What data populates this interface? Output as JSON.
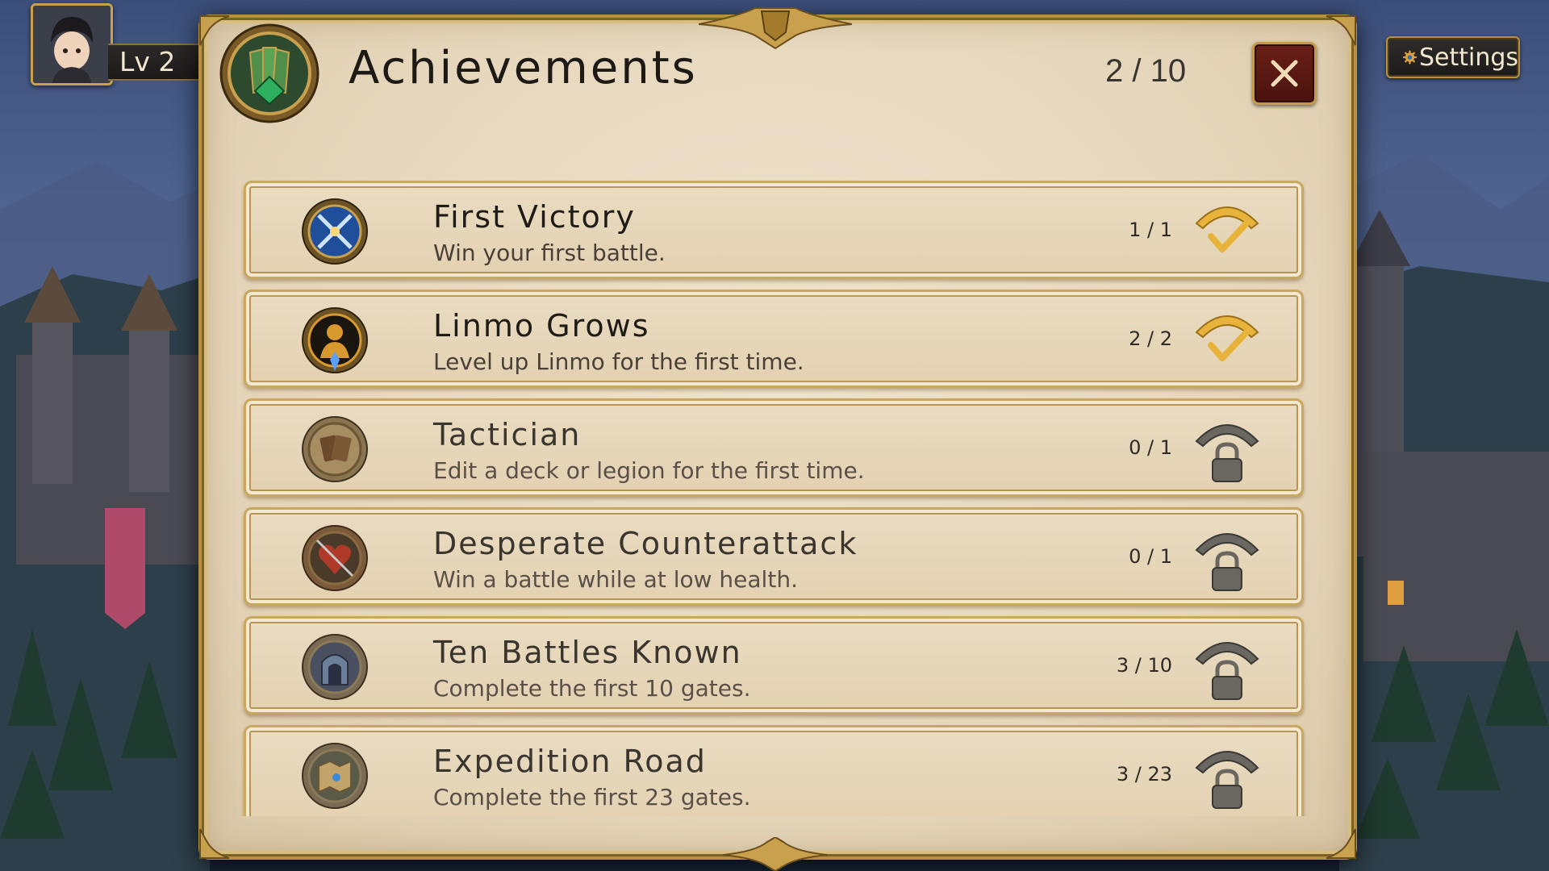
{
  "hud": {
    "level_label": "Lv 2",
    "settings_label": "Settings"
  },
  "panel": {
    "title": "Achievements",
    "count": "2 / 10"
  },
  "achievements": [
    {
      "title": "First Victory",
      "desc": "Win your first battle.",
      "progress": "1 / 1",
      "status": "completed",
      "icon": "crossed-swords-icon",
      "icon_color": "#3f7fd8"
    },
    {
      "title": "Linmo Grows",
      "desc": "Level up Linmo for the first time.",
      "progress": "2 / 2",
      "status": "completed",
      "icon": "hero-silhouette-icon",
      "icon_color": "#d89a2e"
    },
    {
      "title": "Tactician",
      "desc": "Edit a deck or legion for the first time.",
      "progress": "0 / 1",
      "status": "locked",
      "icon": "cards-icon",
      "icon_color": "#b08a4e"
    },
    {
      "title": "Desperate Counterattack",
      "desc": "Win a battle while at low health.",
      "progress": "0 / 1",
      "status": "locked",
      "icon": "heart-sword-icon",
      "icon_color": "#b03a2a"
    },
    {
      "title": "Ten Battles Known",
      "desc": "Complete the first 10 gates.",
      "progress": "3 / 10",
      "status": "locked",
      "icon": "gate-icon",
      "icon_color": "#6c7f9a"
    },
    {
      "title": "Expedition Road",
      "desc": "Complete the first 23 gates.",
      "progress": "3 / 23",
      "status": "locked",
      "icon": "map-icon",
      "icon_color": "#7a8a6a"
    }
  ],
  "colors": {
    "gold": "#c9a04d",
    "parchment": "#e8d9bd",
    "close_red": "#5c1913",
    "check_gold": "#e8b33a",
    "lock_gray": "#6a6660"
  }
}
